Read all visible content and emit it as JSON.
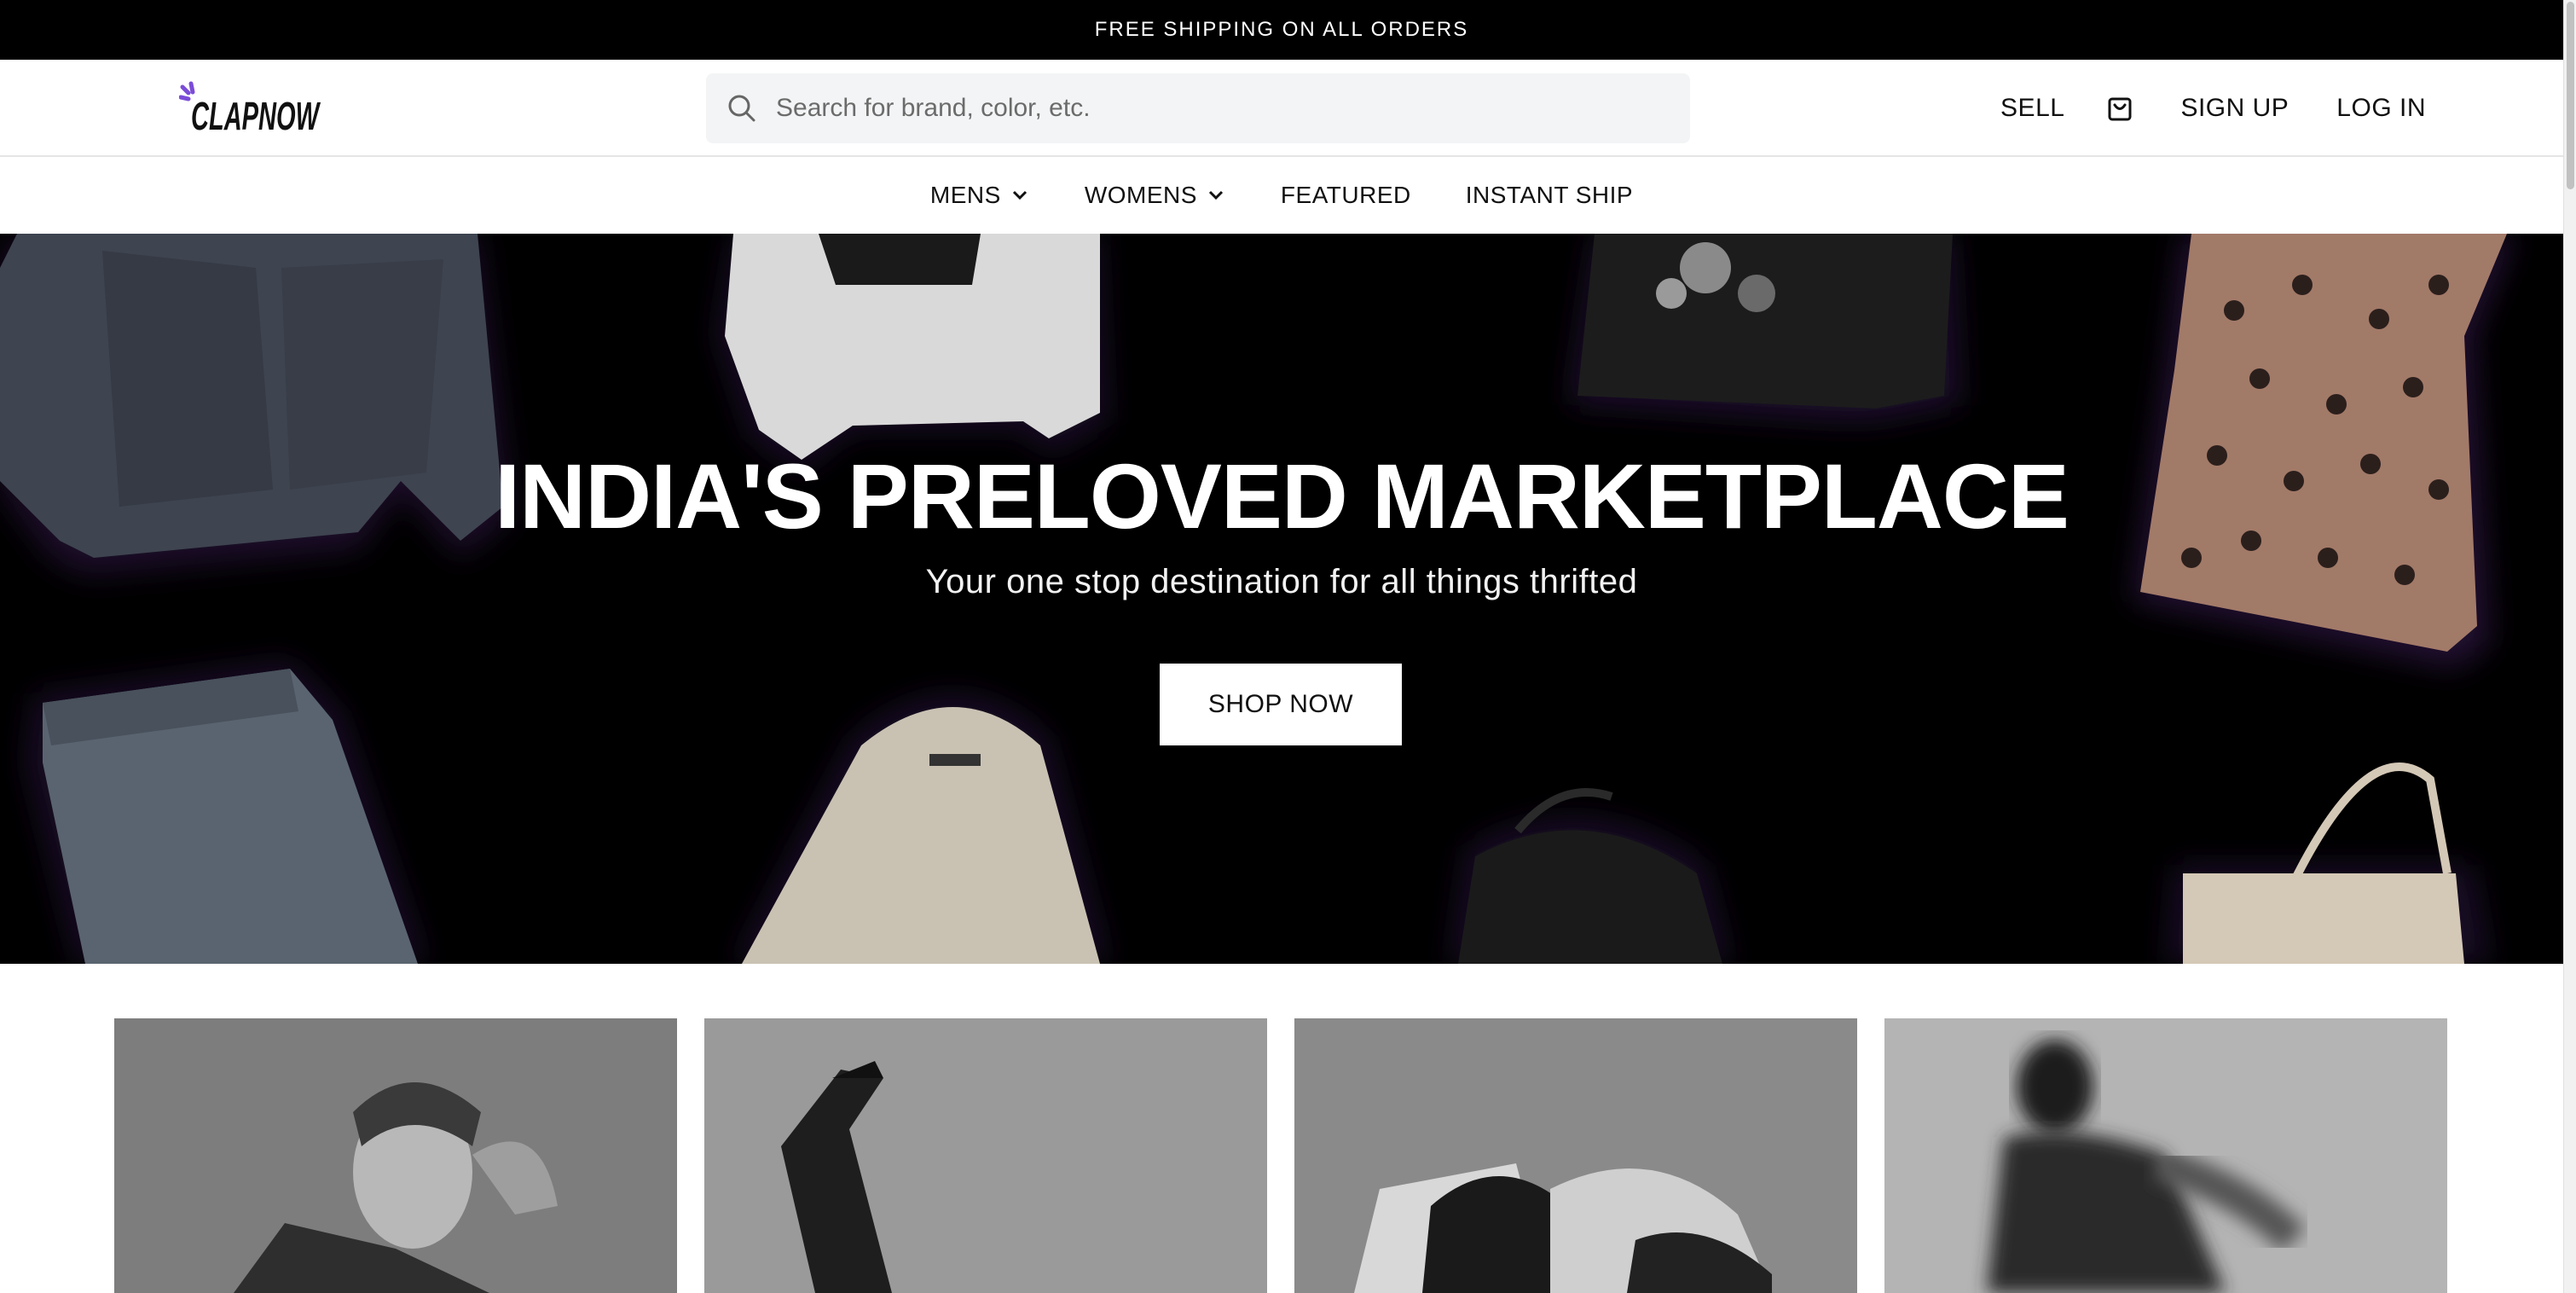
{
  "announcement": {
    "text": "FREE SHIPPING ON ALL ORDERS"
  },
  "brand": {
    "logo_text": "CLAPNOW",
    "accent_color": "#7b4cd8"
  },
  "search": {
    "placeholder": "Search for brand, color, etc.",
    "value": "",
    "icon": "search-icon"
  },
  "header_nav": {
    "sell": "SELL",
    "cart_icon": "shopping-bag-icon",
    "sign_up": "SIGN UP",
    "log_in": "LOG IN"
  },
  "category_nav": [
    {
      "label": "MENS",
      "has_dropdown": true
    },
    {
      "label": "WOMENS",
      "has_dropdown": true
    },
    {
      "label": "FEATURED",
      "has_dropdown": false
    },
    {
      "label": "INSTANT SHIP",
      "has_dropdown": false
    }
  ],
  "hero": {
    "title": "INDIA'S PRELOVED MARKETPLACE",
    "subtitle": "Your one stop destination for all things thrifted",
    "cta": "SHOP NOW"
  },
  "cards": [
    {
      "image": "model-portrait-photo"
    },
    {
      "image": "boots-legs-photo"
    },
    {
      "image": "bag-clothes-photo"
    },
    {
      "image": "motion-blur-person-photo"
    }
  ]
}
